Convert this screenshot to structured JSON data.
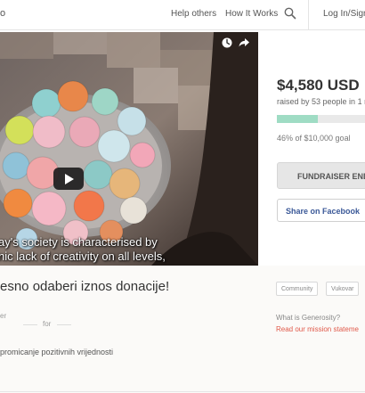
{
  "nav": {
    "brand_fragment": "o",
    "help_others": "Help others",
    "how_it_works": "How It Works",
    "login": "Log In/Sign"
  },
  "video": {
    "caption_line1": "ay's society is characterised by",
    "caption_line2": "nic lack of creativity on all levels,"
  },
  "funding": {
    "amount": "$4,580 USD",
    "raised_text": "raised by 53 people in 1 m",
    "progress_fraction": 0.46,
    "goal_text": "46% of $10,000 goal",
    "ended_label": "FUNDRAISER ENDE",
    "share_label": "Share on Facebook"
  },
  "campaign": {
    "title": "esno odaberi iznos donacije!",
    "meta_left": "er",
    "meta_for": "for",
    "description": "promicanje pozitivnih vrijednosti",
    "tags": [
      "Community",
      "Vukovar"
    ]
  },
  "generosity": {
    "question": "What is Generosity?",
    "link": "Read our mission stateme"
  },
  "colors": {
    "accent_green": "#9fdcc4",
    "link_red": "#e0594a",
    "facebook_blue": "#3b5998"
  }
}
